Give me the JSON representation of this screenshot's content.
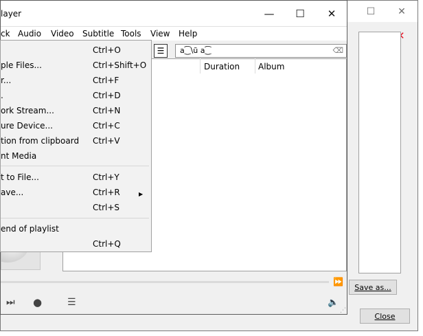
{
  "bg_dialog": {
    "window_controls": {
      "minimize": "—",
      "maximize": "☐",
      "close": "✕"
    },
    "error_close_glyph": "✕",
    "save_as_label": "Save as...",
    "close_label": "Close"
  },
  "vlc": {
    "title": "layer",
    "controls": {
      "minimize": "—",
      "maximize": "☐",
      "close": "✕"
    },
    "menu": [
      "ck",
      "Audio",
      "Video",
      "Subtitle",
      "Tools",
      "View",
      "Help"
    ],
    "search_value": "a⁐\\ũ a⁐",
    "columns": {
      "duration": "Duration",
      "album": "Album"
    },
    "icons": {
      "skip_next": "⏭",
      "stop": "●",
      "playlist": "☰",
      "volume": "🔈",
      "seek_end": "⏩",
      "grip": "⋰"
    }
  },
  "media_menu": {
    "items": [
      {
        "label": "",
        "shortcut": "Ctrl+O"
      },
      {
        "label": "ple Files...",
        "shortcut": "Ctrl+Shift+O"
      },
      {
        "label": "r...",
        "shortcut": "Ctrl+F"
      },
      {
        "label": ".",
        "shortcut": "Ctrl+D"
      },
      {
        "label": "ork Stream...",
        "shortcut": "Ctrl+N"
      },
      {
        "label": "ure Device...",
        "shortcut": "Ctrl+C"
      },
      {
        "label": "tion from clipboard",
        "shortcut": "Ctrl+V"
      },
      {
        "label": "nt Media",
        "shortcut": ""
      },
      {
        "label": "t to File...",
        "shortcut": "Ctrl+Y"
      },
      {
        "label": "ave...",
        "shortcut": "Ctrl+R"
      },
      {
        "label": "",
        "shortcut": "Ctrl+S"
      },
      {
        "label": "end of playlist",
        "shortcut": ""
      },
      {
        "label": "",
        "shortcut": "Ctrl+Q"
      }
    ]
  },
  "colors": {
    "error_red": "#e81123",
    "volume_orange": "#f39200",
    "menu_bg": "#f2f2f2"
  }
}
